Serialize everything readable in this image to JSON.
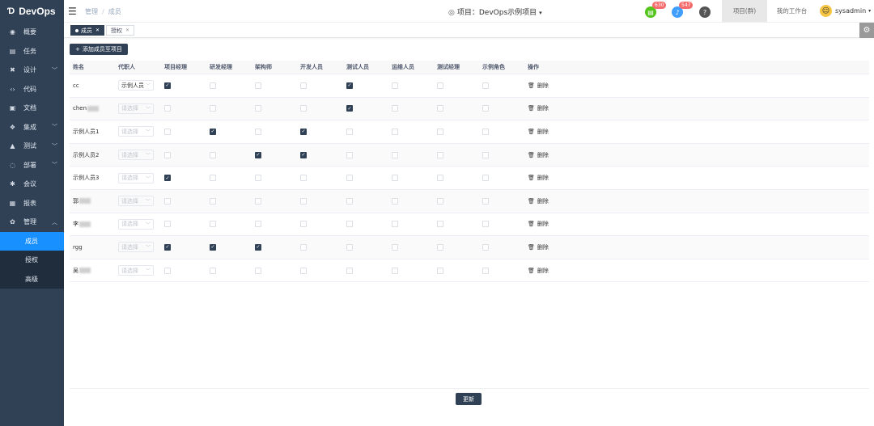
{
  "app": {
    "logo_mark": "Ɗ",
    "title": "DevOps"
  },
  "sidebar": {
    "items": [
      {
        "icon": "dashboard-icon",
        "glyph": "◉",
        "label": "概要",
        "chevron": false
      },
      {
        "icon": "task-icon",
        "glyph": "▤",
        "label": "任务",
        "chevron": false
      },
      {
        "icon": "design-icon",
        "glyph": "✖",
        "label": "设计",
        "chevron": true
      },
      {
        "icon": "code-icon",
        "glyph": "‹›",
        "label": "代码",
        "chevron": false
      },
      {
        "icon": "document-icon",
        "glyph": "▣",
        "label": "文档",
        "chevron": false
      },
      {
        "icon": "integration-icon",
        "glyph": "❖",
        "label": "集成",
        "chevron": true
      },
      {
        "icon": "test-icon",
        "glyph": "▲",
        "label": "测试",
        "chevron": true
      },
      {
        "icon": "deploy-icon",
        "glyph": "◌",
        "label": "部署",
        "chevron": true
      },
      {
        "icon": "meeting-icon",
        "glyph": "✱",
        "label": "会议",
        "chevron": false
      },
      {
        "icon": "report-icon",
        "glyph": "▦",
        "label": "报表",
        "chevron": false
      },
      {
        "icon": "manage-icon",
        "glyph": "✿",
        "label": "管理",
        "chevron": true,
        "expanded": true
      }
    ],
    "subitems": [
      {
        "label": "成员",
        "active": true
      },
      {
        "label": "授权",
        "active": false
      },
      {
        "label": "高级",
        "active": false
      }
    ]
  },
  "header": {
    "breadcrumb": [
      "管理",
      "成员"
    ],
    "project_prefix": "项目：",
    "project_name": "DevOps示例项目",
    "badge_green": "630",
    "badge_blue": "547",
    "help": "?",
    "btn_project": "项目(群)",
    "btn_workspace": "我的工作台",
    "username": "sysadmin",
    "user_caret": "▾"
  },
  "tags": [
    {
      "label": "成员",
      "active": true
    },
    {
      "label": "授权",
      "active": false
    }
  ],
  "toolbar": {
    "add_label": "添加成员至项目"
  },
  "table": {
    "columns": [
      "姓名",
      "代职人",
      "项目经理",
      "研发经理",
      "架构师",
      "开发人员",
      "测试人员",
      "运维人员",
      "测试经理",
      "示例角色",
      "操作"
    ],
    "select_placeholder": "请选择",
    "delete_label": "删除",
    "rows": [
      {
        "name": "cc",
        "blur": false,
        "deputy": "示例人员",
        "checks": [
          true,
          false,
          false,
          false,
          true,
          false,
          false,
          false
        ]
      },
      {
        "name": "chen",
        "blur": true,
        "deputy": "",
        "checks": [
          false,
          false,
          false,
          false,
          true,
          false,
          false,
          false
        ]
      },
      {
        "name": "示例人员1",
        "blur": false,
        "deputy": "",
        "checks": [
          false,
          true,
          false,
          true,
          false,
          false,
          false,
          false
        ]
      },
      {
        "name": "示例人员2",
        "blur": false,
        "deputy": "",
        "checks": [
          false,
          false,
          true,
          true,
          false,
          false,
          false,
          false
        ]
      },
      {
        "name": "示例人员3",
        "blur": false,
        "deputy": "",
        "checks": [
          true,
          false,
          false,
          false,
          false,
          false,
          false,
          false
        ]
      },
      {
        "name": "郭",
        "blur": true,
        "deputy": "",
        "checks": [
          false,
          false,
          false,
          false,
          false,
          false,
          false,
          false
        ]
      },
      {
        "name": "李",
        "blur": true,
        "deputy": "",
        "checks": [
          false,
          false,
          false,
          false,
          false,
          false,
          false,
          false
        ]
      },
      {
        "name": "rgg",
        "blur": false,
        "deputy": "",
        "checks": [
          true,
          true,
          true,
          false,
          false,
          false,
          false,
          false
        ]
      },
      {
        "name": "吴",
        "blur": true,
        "deputy": "",
        "checks": [
          false,
          false,
          false,
          false,
          false,
          false,
          false,
          false
        ]
      }
    ]
  },
  "footer": {
    "update_label": "更新"
  },
  "colors": {
    "sidebar": "#304156",
    "active": "#1890ff",
    "primary_button": "#304156"
  }
}
